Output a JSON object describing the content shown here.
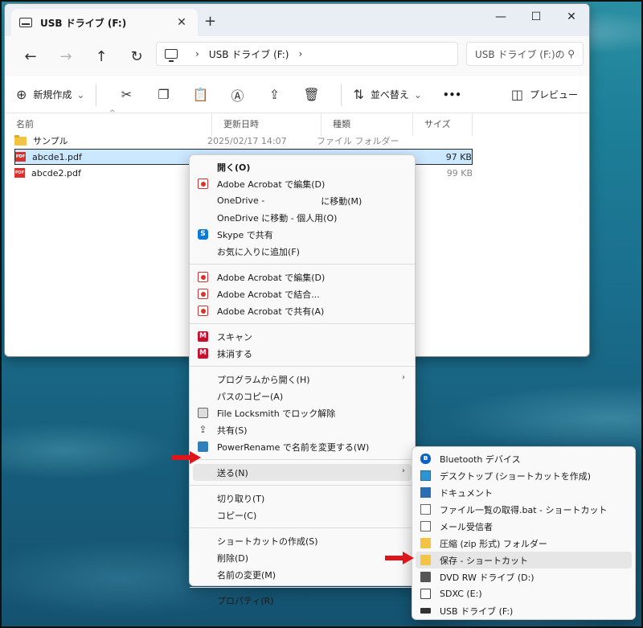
{
  "window": {
    "tab_title": "USB ドライブ (F:)",
    "tab_close": "✕",
    "tab_add": "+",
    "minimize": "—",
    "maximize": "☐",
    "close": "✕"
  },
  "nav": {
    "back": "←",
    "forward": "→",
    "up": "↑",
    "refresh": "↻",
    "address_segment": "USB ドライブ (F:)",
    "chevron": "›",
    "search_placeholder": "USB ドライブ (F:)の",
    "search_icon": "⚲"
  },
  "toolbar": {
    "new_label": "新規作成",
    "new_icon": "⊕",
    "new_chevron": "⌄",
    "cut_icon": "✂",
    "copy_icon": "❐",
    "paste_icon": "📋",
    "rename_icon": "Ⓐ",
    "share_icon": "⇪",
    "delete_icon": "🗑",
    "sort_label": "並べ替え",
    "sort_icon": "⇅",
    "more": "•••",
    "preview_label": "プレビュー",
    "preview_icon": "◫"
  },
  "columns": {
    "name": "名前",
    "date": "更新日時",
    "type": "種類",
    "size": "サイズ",
    "sort_caret": "^"
  },
  "files": [
    {
      "name": "サンプル",
      "date": "2025/02/17 14:07",
      "type": "ファイル フォルダー",
      "size": "",
      "icon": "folder-icon"
    },
    {
      "name": "abcde1.pdf",
      "date": "",
      "type": "",
      "size": "97 KB",
      "icon": "pdf-icon"
    },
    {
      "name": "abcde2.pdf",
      "date": "",
      "type": "",
      "size": "99 KB",
      "icon": "pdf-icon"
    }
  ],
  "context_menu": {
    "open": "開く(O)",
    "acro_edit_1": "Adobe Acrobat で編集(D)",
    "onedrive_move_prefix": "OneDrive -",
    "onedrive_move_suffix": "に移動(M)",
    "onedrive_personal": "OneDrive に移動 - 個人用(O)",
    "skype_share": "Skype で共有",
    "add_favorites": "お気に入りに追加(F)",
    "acro_edit_2": "Adobe Acrobat で編集(D)",
    "acro_combine": "Adobe Acrobat で結合...",
    "acro_share": "Adobe Acrobat で共有(A)",
    "scan": "スキャン",
    "erase": "抹消する",
    "open_with": "プログラムから開く(H)",
    "copy_path": "パスのコピー(A)",
    "locksmith": "File Locksmith でロック解除",
    "share": "共有(S)",
    "powerrename": "PowerRename で名前を変更する(W)",
    "send_to": "送る(N)",
    "cut": "切り取り(T)",
    "copy": "コピー(C)",
    "create_shortcut": "ショートカットの作成(S)",
    "delete": "削除(D)",
    "rename": "名前の変更(M)",
    "properties": "プロパティ(R)",
    "submenu_arrow": "›",
    "skype_glyph": "S",
    "mcafee_glyph": "M"
  },
  "send_to_menu": {
    "bluetooth": "Bluetooth デバイス",
    "desktop": "デスクトップ (ショートカットを作成)",
    "documents": "ドキュメント",
    "bat_shortcut": "ファイル一覧の取得.bat - ショートカット",
    "mail": "メール受信者",
    "zip": "圧縮 (zip 形式) フォルダー",
    "save_shortcut": "保存 - ショートカット",
    "dvd": "DVD RW ドライブ (D:)",
    "sdxc": "SDXC (E:)",
    "usb": "USB ドライブ (F:)",
    "bt_glyph": "ʙ"
  },
  "colors": {
    "accent_selected": "#cce8ff",
    "arrow_red": "#e0141b",
    "pdf_red": "#d9322c",
    "folder_yellow": "#f3c443"
  }
}
